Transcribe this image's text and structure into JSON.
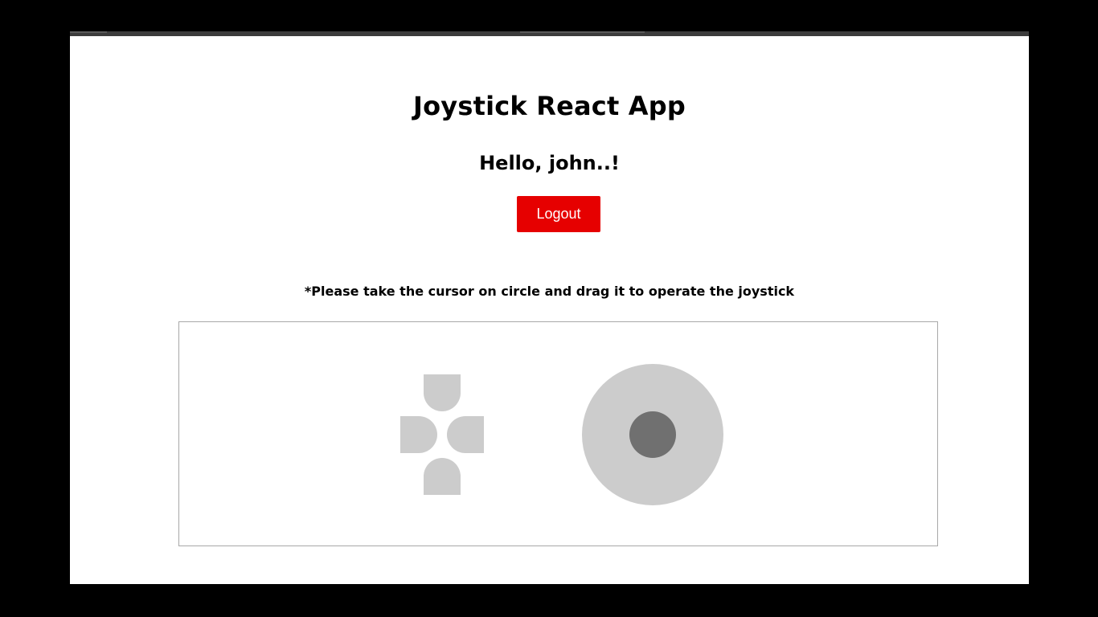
{
  "app": {
    "title": "Joystick React App",
    "greeting": "Hello, john..!",
    "logout_label": "Logout",
    "instruction": "*Please take the cursor on circle and drag it to operate the joystick"
  },
  "colors": {
    "logout_button": "#e60000",
    "dpad": "#cccccc",
    "joystick_base": "#cccccc",
    "joystick_knob": "#707070"
  },
  "icons": {
    "dpad_up": "dpad-up-icon",
    "dpad_down": "dpad-down-icon",
    "dpad_left": "dpad-left-icon",
    "dpad_right": "dpad-right-icon"
  }
}
